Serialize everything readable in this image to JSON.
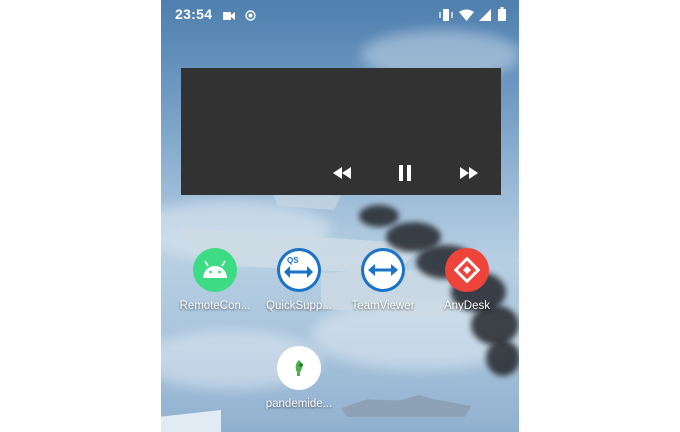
{
  "status_bar": {
    "time": "23:54",
    "left_icons": [
      "video-camera-icon",
      "record-icon"
    ],
    "right_icons": [
      "vibrate-icon",
      "wifi-icon",
      "signal-icon",
      "battery-icon"
    ]
  },
  "media_player": {
    "controls": [
      "rewind-icon",
      "pause-icon",
      "fast-forward-icon"
    ],
    "background": "#323232"
  },
  "apps": [
    {
      "label": "RemoteCon...",
      "icon": "android-icon",
      "color": "#3ddc84"
    },
    {
      "label": "QuickSupp...",
      "icon": "quicksupport-icon",
      "color": "#1a73c8"
    },
    {
      "label": "TeamViewer",
      "icon": "teamviewer-icon",
      "color": "#1a73c8"
    },
    {
      "label": "AnyDesk",
      "icon": "anydesk-icon",
      "color": "#ef443b"
    },
    {
      "label": "pandemide...",
      "icon": "pandemide-app-icon",
      "color": "#ffffff"
    }
  ]
}
